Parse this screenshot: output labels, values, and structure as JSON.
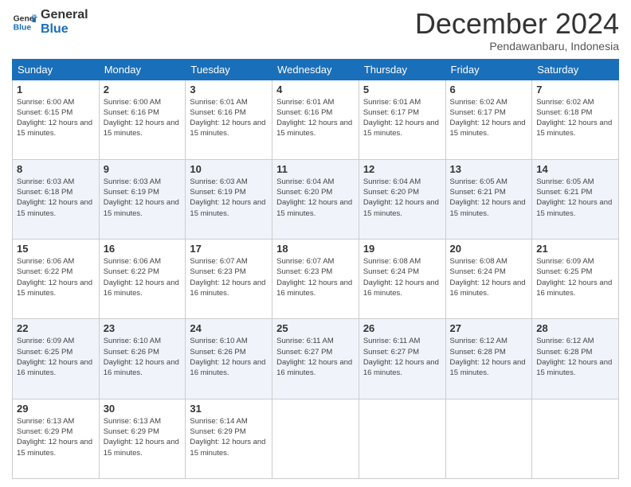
{
  "logo": {
    "text_general": "General",
    "text_blue": "Blue"
  },
  "header": {
    "month": "December 2024",
    "location": "Pendawanbaru, Indonesia"
  },
  "weekdays": [
    "Sunday",
    "Monday",
    "Tuesday",
    "Wednesday",
    "Thursday",
    "Friday",
    "Saturday"
  ],
  "weeks": [
    [
      {
        "day": "1",
        "sunrise": "6:00 AM",
        "sunset": "6:15 PM",
        "daylight": "12 hours and 15 minutes."
      },
      {
        "day": "2",
        "sunrise": "6:00 AM",
        "sunset": "6:16 PM",
        "daylight": "12 hours and 15 minutes."
      },
      {
        "day": "3",
        "sunrise": "6:01 AM",
        "sunset": "6:16 PM",
        "daylight": "12 hours and 15 minutes."
      },
      {
        "day": "4",
        "sunrise": "6:01 AM",
        "sunset": "6:16 PM",
        "daylight": "12 hours and 15 minutes."
      },
      {
        "day": "5",
        "sunrise": "6:01 AM",
        "sunset": "6:17 PM",
        "daylight": "12 hours and 15 minutes."
      },
      {
        "day": "6",
        "sunrise": "6:02 AM",
        "sunset": "6:17 PM",
        "daylight": "12 hours and 15 minutes."
      },
      {
        "day": "7",
        "sunrise": "6:02 AM",
        "sunset": "6:18 PM",
        "daylight": "12 hours and 15 minutes."
      }
    ],
    [
      {
        "day": "8",
        "sunrise": "6:03 AM",
        "sunset": "6:18 PM",
        "daylight": "12 hours and 15 minutes."
      },
      {
        "day": "9",
        "sunrise": "6:03 AM",
        "sunset": "6:19 PM",
        "daylight": "12 hours and 15 minutes."
      },
      {
        "day": "10",
        "sunrise": "6:03 AM",
        "sunset": "6:19 PM",
        "daylight": "12 hours and 15 minutes."
      },
      {
        "day": "11",
        "sunrise": "6:04 AM",
        "sunset": "6:20 PM",
        "daylight": "12 hours and 15 minutes."
      },
      {
        "day": "12",
        "sunrise": "6:04 AM",
        "sunset": "6:20 PM",
        "daylight": "12 hours and 15 minutes."
      },
      {
        "day": "13",
        "sunrise": "6:05 AM",
        "sunset": "6:21 PM",
        "daylight": "12 hours and 15 minutes."
      },
      {
        "day": "14",
        "sunrise": "6:05 AM",
        "sunset": "6:21 PM",
        "daylight": "12 hours and 15 minutes."
      }
    ],
    [
      {
        "day": "15",
        "sunrise": "6:06 AM",
        "sunset": "6:22 PM",
        "daylight": "12 hours and 15 minutes."
      },
      {
        "day": "16",
        "sunrise": "6:06 AM",
        "sunset": "6:22 PM",
        "daylight": "12 hours and 16 minutes."
      },
      {
        "day": "17",
        "sunrise": "6:07 AM",
        "sunset": "6:23 PM",
        "daylight": "12 hours and 16 minutes."
      },
      {
        "day": "18",
        "sunrise": "6:07 AM",
        "sunset": "6:23 PM",
        "daylight": "12 hours and 16 minutes."
      },
      {
        "day": "19",
        "sunrise": "6:08 AM",
        "sunset": "6:24 PM",
        "daylight": "12 hours and 16 minutes."
      },
      {
        "day": "20",
        "sunrise": "6:08 AM",
        "sunset": "6:24 PM",
        "daylight": "12 hours and 16 minutes."
      },
      {
        "day": "21",
        "sunrise": "6:09 AM",
        "sunset": "6:25 PM",
        "daylight": "12 hours and 16 minutes."
      }
    ],
    [
      {
        "day": "22",
        "sunrise": "6:09 AM",
        "sunset": "6:25 PM",
        "daylight": "12 hours and 16 minutes."
      },
      {
        "day": "23",
        "sunrise": "6:10 AM",
        "sunset": "6:26 PM",
        "daylight": "12 hours and 16 minutes."
      },
      {
        "day": "24",
        "sunrise": "6:10 AM",
        "sunset": "6:26 PM",
        "daylight": "12 hours and 16 minutes."
      },
      {
        "day": "25",
        "sunrise": "6:11 AM",
        "sunset": "6:27 PM",
        "daylight": "12 hours and 16 minutes."
      },
      {
        "day": "26",
        "sunrise": "6:11 AM",
        "sunset": "6:27 PM",
        "daylight": "12 hours and 16 minutes."
      },
      {
        "day": "27",
        "sunrise": "6:12 AM",
        "sunset": "6:28 PM",
        "daylight": "12 hours and 15 minutes."
      },
      {
        "day": "28",
        "sunrise": "6:12 AM",
        "sunset": "6:28 PM",
        "daylight": "12 hours and 15 minutes."
      }
    ],
    [
      {
        "day": "29",
        "sunrise": "6:13 AM",
        "sunset": "6:29 PM",
        "daylight": "12 hours and 15 minutes."
      },
      {
        "day": "30",
        "sunrise": "6:13 AM",
        "sunset": "6:29 PM",
        "daylight": "12 hours and 15 minutes."
      },
      {
        "day": "31",
        "sunrise": "6:14 AM",
        "sunset": "6:29 PM",
        "daylight": "12 hours and 15 minutes."
      },
      null,
      null,
      null,
      null
    ]
  ],
  "labels": {
    "sunrise": "Sunrise:",
    "sunset": "Sunset:",
    "daylight": "Daylight:"
  }
}
